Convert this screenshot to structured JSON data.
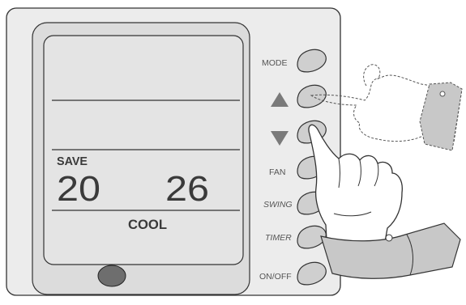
{
  "colors": {
    "panel_fill": "#ececec",
    "panel_stroke": "#333333",
    "lcd_fill": "#e4e4e4",
    "button_fill": "#cfcfcf",
    "arrow_fill": "#7a7a7a",
    "hand_fill": "#ffffff",
    "cuff_fill": "#c8c8c8"
  },
  "display": {
    "save_label": "SAVE",
    "set_temperature": "20",
    "room_temperature": "26",
    "mode": "COOL"
  },
  "buttons": [
    {
      "key": "mode",
      "label": "MODE",
      "italic": false
    },
    {
      "key": "up",
      "label": "",
      "icon": "up-arrow-icon"
    },
    {
      "key": "down",
      "label": "",
      "icon": "down-arrow-icon"
    },
    {
      "key": "fan",
      "label": "FAN",
      "italic": false
    },
    {
      "key": "swing",
      "label": "SWING",
      "italic": true
    },
    {
      "key": "timer",
      "label": "TIMER",
      "italic": true
    },
    {
      "key": "onoff",
      "label": "ON/OFF",
      "italic": false
    }
  ],
  "icons": [
    "up-arrow-icon",
    "down-arrow-icon",
    "pointing-hand-icon",
    "ghost-hand-icon",
    "sensor-dot-icon"
  ]
}
